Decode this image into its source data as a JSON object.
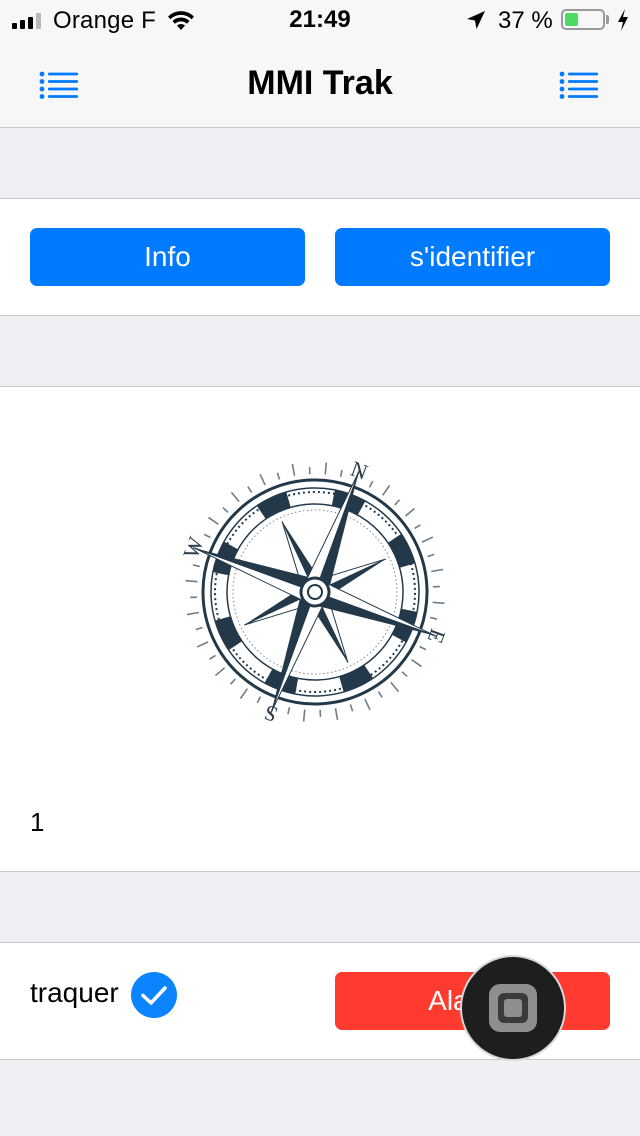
{
  "status_bar": {
    "carrier": "Orange F",
    "time": "21:49",
    "battery_percent": "37 %",
    "battery_level": 0.37,
    "battery_color": "#4cd964"
  },
  "nav": {
    "title": "MMI Trak",
    "left_icon": "list-icon",
    "right_icon": "list-icon",
    "icon_color": "#007aff"
  },
  "buttons": {
    "info_label": "Info",
    "login_label": "s'identifier",
    "alarm_label": "Alarme"
  },
  "compass": {
    "icon": "compass-rose-icon",
    "letters": {
      "n": "N",
      "s": "S",
      "e": "E",
      "w": "W"
    }
  },
  "counter": {
    "value": "1"
  },
  "tracking": {
    "label": "traquer",
    "checked": true
  },
  "colors": {
    "accent": "#007aff",
    "danger": "#ff3b30",
    "background": "#efeff4"
  }
}
